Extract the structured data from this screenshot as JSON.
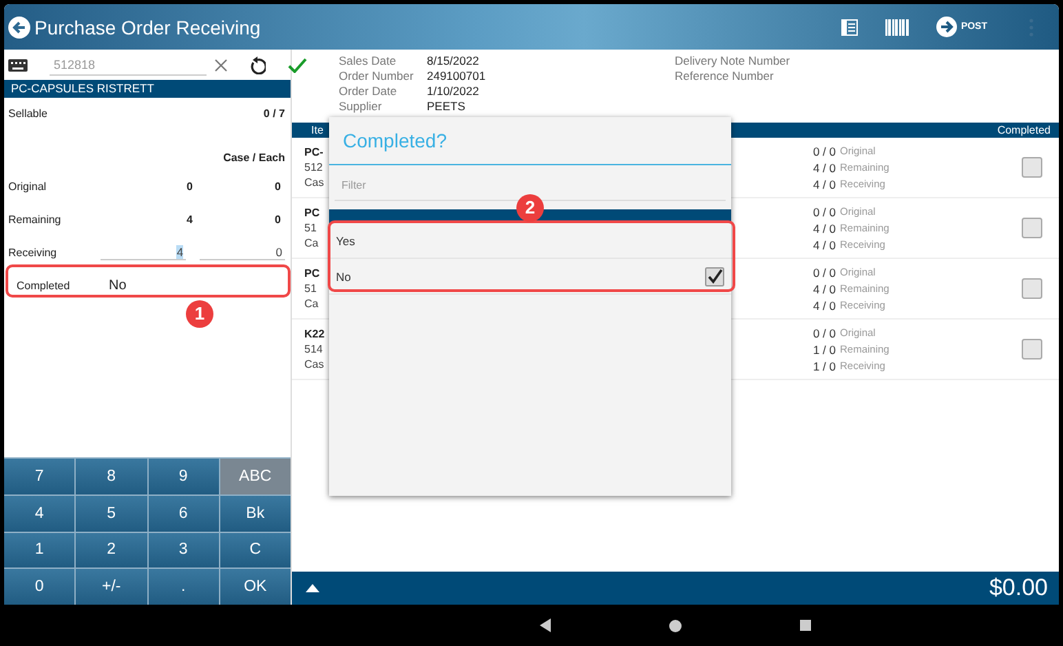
{
  "app_bar": {
    "title": "Purchase Order Receiving",
    "post_label": "POST"
  },
  "scan": {
    "placeholder": "512818"
  },
  "product": {
    "name": "PC-CAPSULES RISTRETT",
    "sellable_label": "Sellable",
    "sellable": "0 / 7",
    "units_header": "Case / Each",
    "rows": [
      {
        "kind": "readonly",
        "label": "Original",
        "case": "0",
        "each": "0"
      },
      {
        "kind": "readonly",
        "label": "Remaining",
        "case": "4",
        "each": "0"
      },
      {
        "kind": "input",
        "label": "Receiving",
        "case": "4",
        "each": "0",
        "case_selected": true
      }
    ],
    "completed": {
      "label": "Completed",
      "value": "No"
    }
  },
  "keypad": [
    {
      "label": "7",
      "kind": "key"
    },
    {
      "label": "8",
      "kind": "key"
    },
    {
      "label": "9",
      "kind": "key"
    },
    {
      "label": "ABC",
      "kind": "mode"
    },
    {
      "label": "4",
      "kind": "key"
    },
    {
      "label": "5",
      "kind": "key"
    },
    {
      "label": "6",
      "kind": "key"
    },
    {
      "label": "Bk",
      "kind": "key"
    },
    {
      "label": "1",
      "kind": "key"
    },
    {
      "label": "2",
      "kind": "key"
    },
    {
      "label": "3",
      "kind": "key"
    },
    {
      "label": "C",
      "kind": "key"
    },
    {
      "label": "0",
      "kind": "key"
    },
    {
      "label": "+/-",
      "kind": "key"
    },
    {
      "label": ".",
      "kind": "key"
    },
    {
      "label": "OK",
      "kind": "key"
    }
  ],
  "order": {
    "fields": [
      {
        "label": "Sales Date",
        "value": "8/15/2022"
      },
      {
        "label": "Order Number",
        "value": "249100701"
      },
      {
        "label": "Order Date",
        "value": "1/10/2022"
      },
      {
        "label": "Supplier",
        "value": "PEETS"
      }
    ],
    "extra_fields": [
      {
        "label": "Delivery Note Number"
      },
      {
        "label": "Reference Number"
      }
    ]
  },
  "table": {
    "columns": [
      "Ite",
      "Completed"
    ],
    "rows": [
      {
        "code": "PC-",
        "number": "512",
        "unit": "Cas",
        "quantities": [
          {
            "amount": "0 / 0",
            "caption": "Original"
          },
          {
            "amount": "4 / 0",
            "caption": "Remaining"
          },
          {
            "amount": "4 / 0",
            "caption": "Receiving"
          }
        ],
        "completed": false
      },
      {
        "code": "PC",
        "number": "51",
        "unit": "Ca",
        "quantities": [
          {
            "amount": "0 / 0",
            "caption": "Original"
          },
          {
            "amount": "4 / 0",
            "caption": "Remaining"
          },
          {
            "amount": "4 / 0",
            "caption": "Receiving"
          }
        ],
        "completed": false
      },
      {
        "code": "PC",
        "number": "51",
        "unit": "Ca",
        "quantities": [
          {
            "amount": "0 / 0",
            "caption": "Original"
          },
          {
            "amount": "4 / 0",
            "caption": "Remaining"
          },
          {
            "amount": "4 / 0",
            "caption": "Receiving"
          }
        ],
        "completed": false
      },
      {
        "code": "K22",
        "number": "514",
        "unit": "Cas",
        "quantities": [
          {
            "amount": "0 / 0",
            "caption": "Original"
          },
          {
            "amount": "1 / 0",
            "caption": "Remaining"
          },
          {
            "amount": "1 / 0",
            "caption": "Receiving"
          }
        ],
        "completed": false
      }
    ]
  },
  "total": "$0.00",
  "dialog": {
    "title": "Completed?",
    "filter_placeholder": "Filter",
    "options": [
      {
        "label": "Yes",
        "selected": false
      },
      {
        "label": "No",
        "selected": true
      }
    ]
  },
  "callouts": [
    {
      "number": "1"
    },
    {
      "number": "2"
    }
  ]
}
